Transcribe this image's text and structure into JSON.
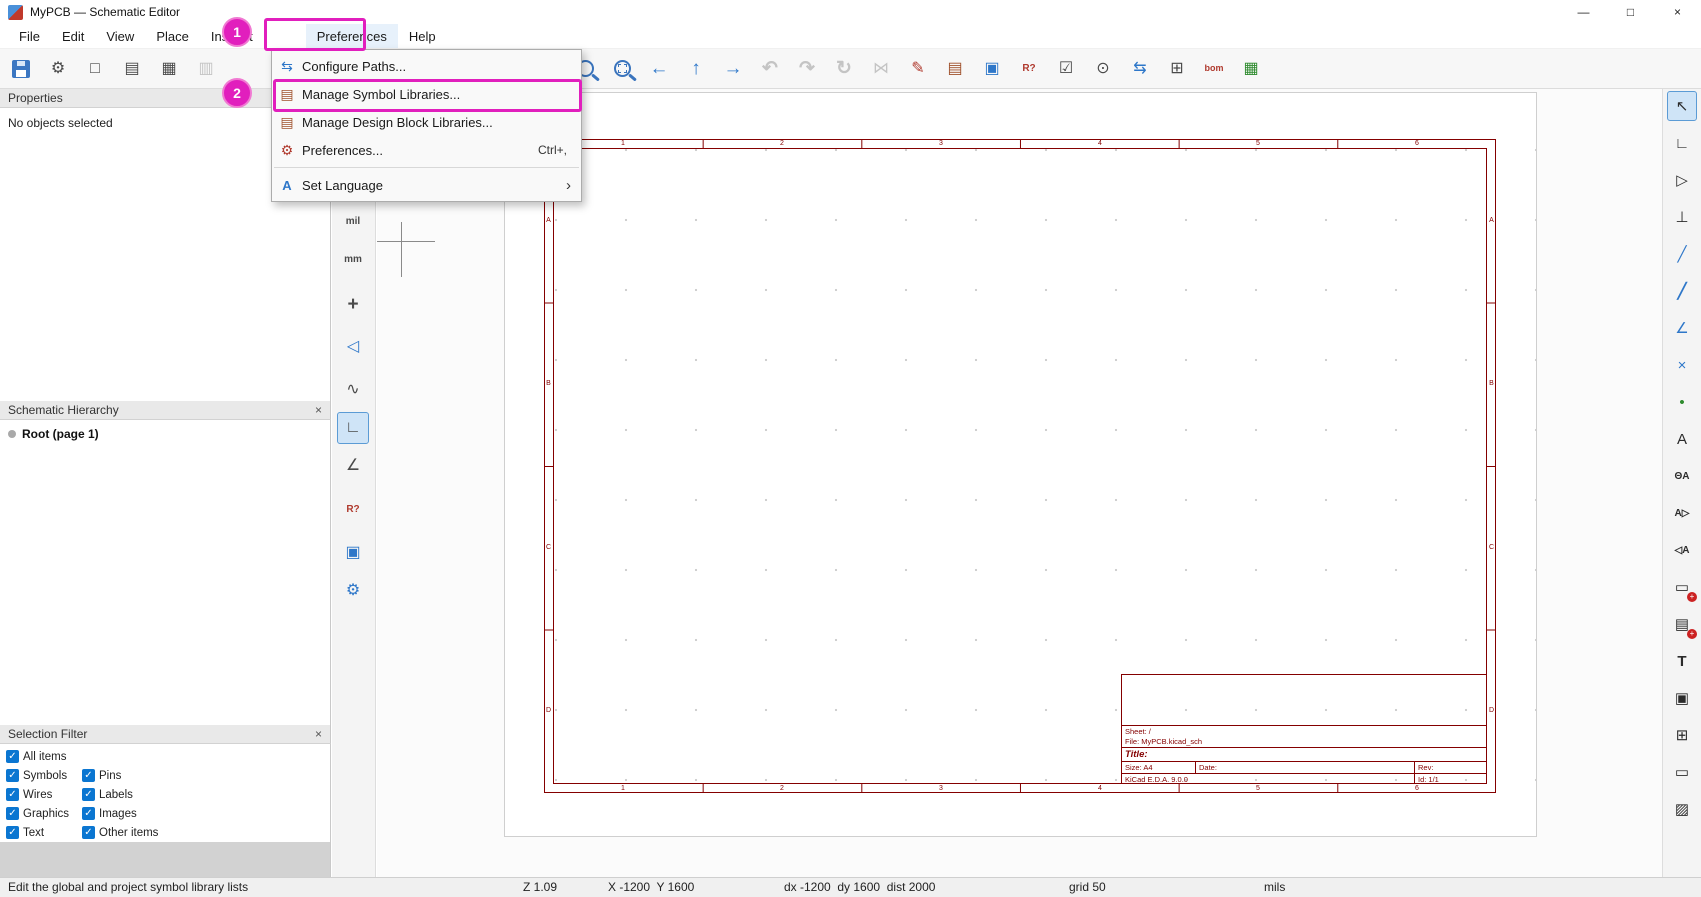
{
  "titlebar": {
    "app_title": "MyPCB — Schematic Editor",
    "minimize": "—",
    "maximize": "□",
    "close": "×"
  },
  "menubar": {
    "items": [
      "File",
      "Edit",
      "View",
      "Place",
      "Inspect",
      "Preferences",
      "Help"
    ]
  },
  "preferences_menu": {
    "items": [
      {
        "name": "configure-paths",
        "glyph": "⇆",
        "label": "Configure Paths...",
        "shortcut": ""
      },
      {
        "name": "manage-symbol-libraries",
        "glyph": "▤",
        "label": "Manage Symbol Libraries...",
        "shortcut": ""
      },
      {
        "name": "manage-design-block-libraries",
        "glyph": "▤",
        "label": "Manage Design Block Libraries...",
        "shortcut": ""
      },
      {
        "name": "preferences",
        "glyph": "⚙",
        "label": "Preferences...",
        "shortcut": "Ctrl+,"
      },
      {
        "name": "set-language",
        "glyph": "A",
        "label": "Set Language",
        "submenu_arrow": "›"
      }
    ]
  },
  "annotations": {
    "step1": "1",
    "step2": "2",
    "highlight_color": "#e11fbd"
  },
  "top_toolbar": {
    "buttons": [
      {
        "name": "save",
        "glyph": ""
      },
      {
        "name": "schematic-setup",
        "glyph": "⚙"
      },
      {
        "name": "page-settings",
        "glyph": "□"
      },
      {
        "name": "print",
        "glyph": "▤"
      },
      {
        "name": "plot",
        "glyph": "▦"
      },
      {
        "name": "paste",
        "glyph": "▥",
        "disabled": true
      },
      {
        "name": "zoom-fit",
        "glyph": ""
      },
      {
        "name": "zoom-to-selection",
        "glyph": ""
      },
      {
        "name": "nav-back",
        "glyph": "←"
      },
      {
        "name": "nav-up",
        "glyph": "↑"
      },
      {
        "name": "nav-forward",
        "glyph": "→"
      },
      {
        "name": "undo",
        "glyph": "↶",
        "disabled": true
      },
      {
        "name": "redo",
        "glyph": "↷",
        "disabled": true
      },
      {
        "name": "rotate",
        "glyph": "↻",
        "disabled": true
      },
      {
        "name": "mirror",
        "glyph": "⋈",
        "disabled": true
      },
      {
        "name": "symbol-editor",
        "glyph": "✎"
      },
      {
        "name": "symbol-browser",
        "glyph": "▤"
      },
      {
        "name": "hierarchy-browser",
        "glyph": "▣"
      },
      {
        "name": "annotate",
        "glyph": "R?"
      },
      {
        "name": "erc",
        "glyph": "☑"
      },
      {
        "name": "simulator",
        "glyph": "⊙"
      },
      {
        "name": "assign-footprints",
        "glyph": "⇆"
      },
      {
        "name": "symbol-fields-table",
        "glyph": "⊞"
      },
      {
        "name": "bom",
        "glyph": "bom"
      },
      {
        "name": "open-pcb-editor",
        "glyph": "▦"
      }
    ]
  },
  "left_toolbar": {
    "buttons": [
      {
        "name": "mil-units",
        "glyph": "mil"
      },
      {
        "name": "mm-units",
        "glyph": "mm"
      },
      {
        "name": "crosshair-style",
        "glyph": "+"
      },
      {
        "name": "hidden-pins",
        "glyph": "◁"
      },
      {
        "name": "sim-operating-points",
        "glyph": "∿"
      },
      {
        "name": "hv-wires",
        "glyph": "∟",
        "selected": true
      },
      {
        "name": "free-angle-wires",
        "glyph": "∠"
      },
      {
        "name": "hidden-fields",
        "glyph": "R?"
      },
      {
        "name": "hierarchy-navigator",
        "glyph": "▣"
      },
      {
        "name": "properties-manager",
        "glyph": "⚙"
      }
    ]
  },
  "right_toolbar": {
    "buttons": [
      {
        "name": "select-tool",
        "glyph": "↖",
        "selected": true
      },
      {
        "name": "highlight-net-tool",
        "glyph": "∟"
      },
      {
        "name": "place-symbol-tool",
        "glyph": "▷"
      },
      {
        "name": "place-power-tool",
        "glyph": "⊥"
      },
      {
        "name": "draw-wire-tool",
        "glyph": "╱"
      },
      {
        "name": "draw-bus-tool",
        "glyph": "╱"
      },
      {
        "name": "wire-bus-entry-tool",
        "glyph": "∠"
      },
      {
        "name": "no-connect-tool",
        "glyph": "×"
      },
      {
        "name": "junction-tool",
        "glyph": "•"
      },
      {
        "name": "net-label-tool",
        "glyph": "A"
      },
      {
        "name": "net-class-directive-tool",
        "glyph": "ΘA"
      },
      {
        "name": "global-label-tool",
        "glyph": "A▷"
      },
      {
        "name": "hierarchical-label-tool",
        "glyph": "◁A"
      },
      {
        "name": "hierarchical-sheet-tool",
        "glyph": "▭"
      },
      {
        "name": "sheet-pin-tool",
        "glyph": "▤"
      },
      {
        "name": "text-tool",
        "glyph": "T"
      },
      {
        "name": "textbox-tool",
        "glyph": "▣"
      },
      {
        "name": "table-tool",
        "glyph": "⊞"
      },
      {
        "name": "rectangle-tool",
        "glyph": "▭"
      },
      {
        "name": "image-tool",
        "glyph": "▨"
      }
    ]
  },
  "properties_panel": {
    "title": "Properties",
    "empty_message": "No objects selected"
  },
  "hierarchy_panel": {
    "title": "Schematic Hierarchy",
    "close": "×",
    "root_item": "Root (page 1)"
  },
  "selection_filter": {
    "title": "Selection Filter",
    "close": "×",
    "items": [
      "All items",
      "Symbols",
      "Pins",
      "Wires",
      "Labels",
      "Graphics",
      "Images",
      "Text",
      "Other items"
    ]
  },
  "sheet": {
    "column_labels": [
      "1",
      "2",
      "3",
      "4",
      "5",
      "6"
    ],
    "row_labels": [
      "A",
      "B",
      "C",
      "D"
    ],
    "title_block": {
      "sheet": "Sheet: /",
      "file": "File: MyPCB.kicad_sch",
      "title": "Title:",
      "size": "Size: A4",
      "date": "Date:",
      "rev": "Rev:",
      "generator": "KiCad E.D.A. 9.0.0",
      "page_id": "Id: 1/1"
    }
  },
  "status_bar": {
    "hint": "Edit the global and project symbol library lists",
    "zoom": "Z 1.09",
    "cursor": "X -1200  Y 1600",
    "delta": "dx -1200  dy 1600  dist 2000",
    "grid": "grid 50",
    "units": "mils"
  },
  "colors": {
    "accent_blue": "#2e77c9",
    "frame_red": "#840000",
    "annotation_magenta": "#e11fbd",
    "check_blue": "#0b76d1"
  }
}
